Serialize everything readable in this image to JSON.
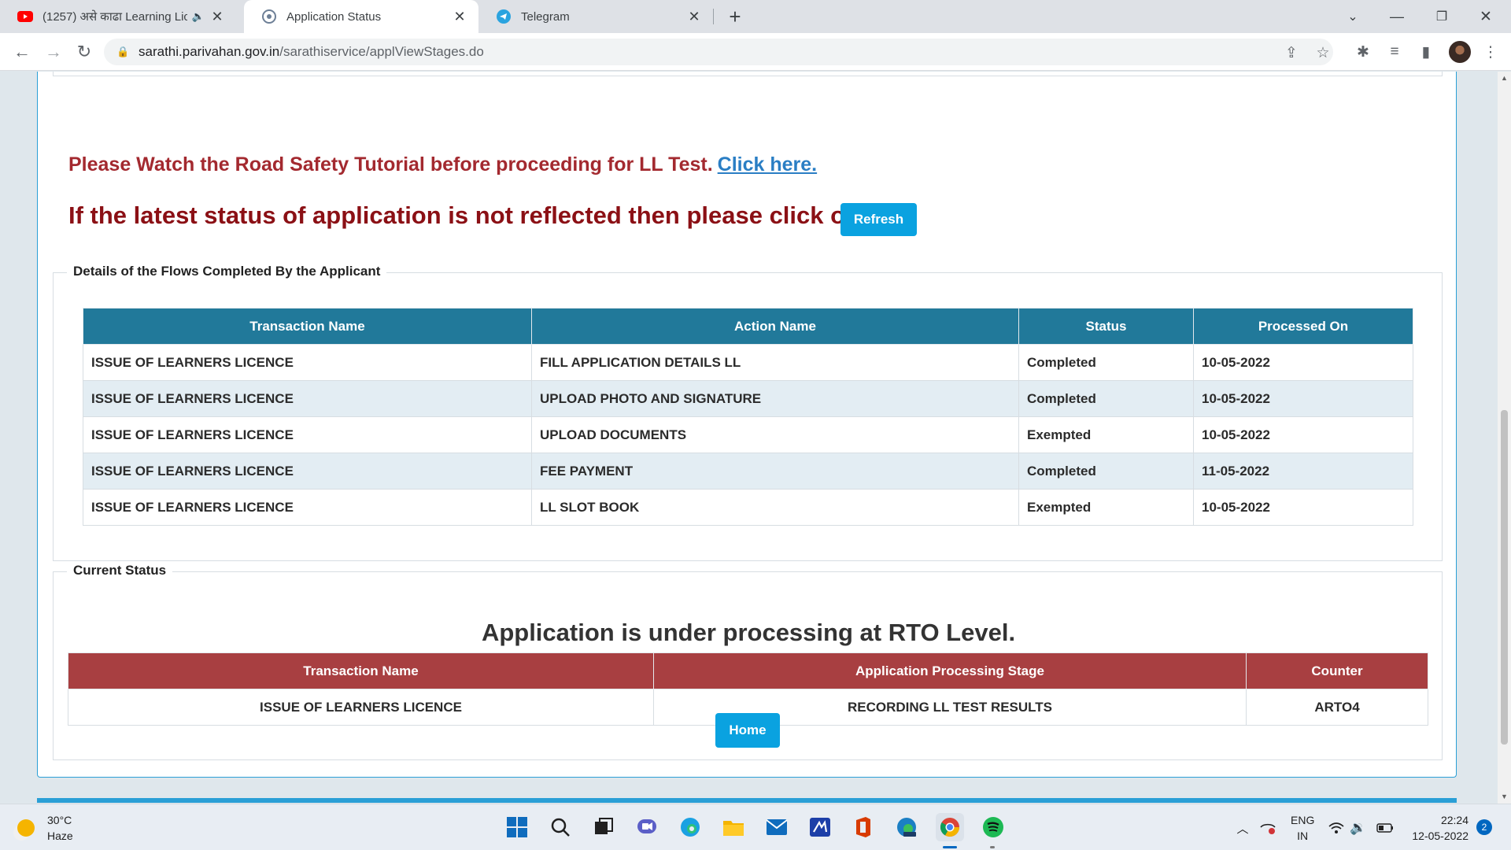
{
  "browser": {
    "tabs": [
      {
        "title": "(1257) असे काढा Learning Lic",
        "icon": "youtube-icon",
        "active": false
      },
      {
        "title": "Application Status",
        "icon": "site-icon",
        "active": true
      },
      {
        "title": "Telegram",
        "icon": "telegram-icon",
        "active": false
      }
    ],
    "url_host": "sarathi.parivahan.gov.in",
    "url_path": "/sarathiservice/applViewStages.do"
  },
  "page": {
    "tutorial_text": "Please Watch the Road Safety Tutorial before proceeding for LL Test.",
    "tutorial_link": "Click here.",
    "status_text": "If the latest status of application is not reflected then please click on",
    "refresh_label": "Refresh",
    "flows": {
      "legend": "Details of the Flows Completed By the Applicant",
      "headers": [
        "Transaction Name",
        "Action Name",
        "Status",
        "Processed On"
      ],
      "rows": [
        [
          "ISSUE OF LEARNERS LICENCE",
          "FILL APPLICATION DETAILS LL",
          "Completed",
          "10-05-2022"
        ],
        [
          "ISSUE OF LEARNERS LICENCE",
          "UPLOAD PHOTO AND SIGNATURE",
          "Completed",
          "10-05-2022"
        ],
        [
          "ISSUE OF LEARNERS LICENCE",
          "UPLOAD DOCUMENTS",
          "Exempted",
          "10-05-2022"
        ],
        [
          "ISSUE OF LEARNERS LICENCE",
          "FEE PAYMENT",
          "Completed",
          "11-05-2022"
        ],
        [
          "ISSUE OF LEARNERS LICENCE",
          "LL SLOT BOOK",
          "Exempted",
          "10-05-2022"
        ]
      ]
    },
    "current": {
      "legend": "Current Status",
      "message": "Application is under processing at RTO Level.",
      "headers": [
        "Transaction Name",
        "Application Processing Stage",
        "Counter"
      ],
      "row": [
        "ISSUE OF LEARNERS LICENCE",
        "RECORDING LL TEST RESULTS",
        "ARTO4"
      ]
    },
    "home_label": "Home"
  },
  "taskbar": {
    "temperature": "30°C",
    "weather": "Haze",
    "lang_top": "ENG",
    "lang_bottom": "IN",
    "time": "22:24",
    "date": "12-05-2022",
    "notifications": "2"
  },
  "colors": {
    "table_header_blue": "#21799a",
    "table_header_red": "#a83f41",
    "button_blue": "#0aa2e0",
    "alert_red": "#a3292f"
  }
}
